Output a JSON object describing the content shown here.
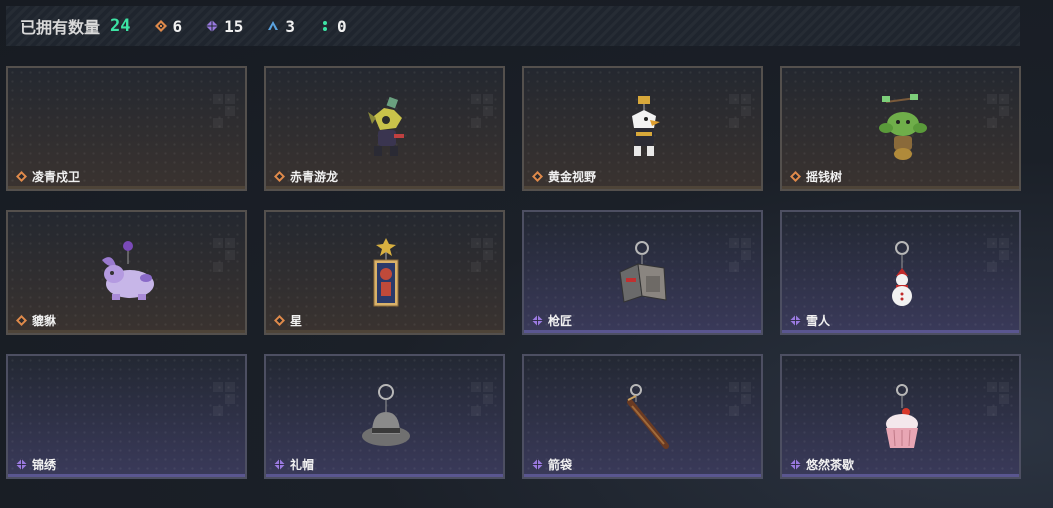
{
  "header": {
    "owned_label": "已拥有数量",
    "owned_count": "24",
    "stats": [
      {
        "icon": "orange-diamond-icon",
        "color": "#e08a4a",
        "value": "6"
      },
      {
        "icon": "purple-diamond-icon",
        "color": "#9a7ae0",
        "value": "15"
      },
      {
        "icon": "blue-triangle-icon",
        "color": "#5aa3e0",
        "value": "3"
      },
      {
        "icon": "green-dots-icon",
        "color": "#3de3a4",
        "value": "0"
      }
    ]
  },
  "colors": {
    "accent_green": "#3de3a4",
    "rarity_orange": "#e08a4a",
    "rarity_purple": "#9a7ae0"
  },
  "cards": [
    {
      "name": "凌青戍卫",
      "rarity": "orange",
      "art": "none"
    },
    {
      "name": "赤青游龙",
      "rarity": "orange",
      "art": "dragon-figure"
    },
    {
      "name": "黄金视野",
      "rarity": "orange",
      "art": "eagle-figure"
    },
    {
      "name": "摇钱树",
      "rarity": "orange",
      "art": "goblin-figure"
    },
    {
      "name": "貔貅",
      "rarity": "orange",
      "art": "purple-beast"
    },
    {
      "name": "星",
      "rarity": "orange",
      "art": "tarot-card"
    },
    {
      "name": "枪匠",
      "rarity": "purple",
      "art": "gun-case-keychain"
    },
    {
      "name": "雪人",
      "rarity": "purple",
      "art": "snowman-keychain"
    },
    {
      "name": "锦绣",
      "rarity": "purple",
      "art": "none"
    },
    {
      "name": "礼帽",
      "rarity": "purple",
      "art": "hat-keychain"
    },
    {
      "name": "箭袋",
      "rarity": "purple",
      "art": "quiver-keychain"
    },
    {
      "name": "悠然茶歇",
      "rarity": "purple",
      "art": "cupcake-keychain"
    }
  ]
}
